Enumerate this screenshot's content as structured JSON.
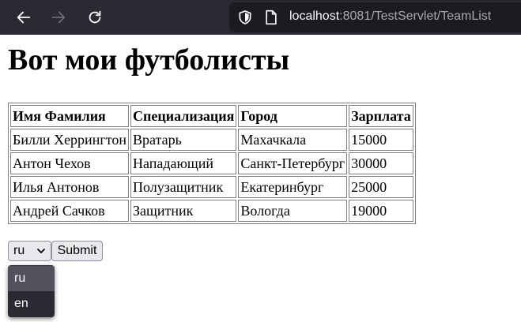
{
  "browser": {
    "url_host": "localhost",
    "url_rest": ":8081/TestServlet/TeamList"
  },
  "page": {
    "title": "Вот мои футболисты"
  },
  "table": {
    "headers": [
      "Имя Фамилия",
      "Специализация",
      "Город",
      "Зарплата"
    ],
    "rows": [
      [
        "Билли Херрингтон",
        "Вратарь",
        "Махачкала",
        "15000"
      ],
      [
        "Антон Чехов",
        "Нападающий",
        "Санкт-Петербург",
        "30000"
      ],
      [
        "Илья Антонов",
        "Полузащитник",
        "Екатеринбург",
        "25000"
      ],
      [
        "Андрей Сачков",
        "Защитник",
        "Вологда",
        "19000"
      ]
    ]
  },
  "form": {
    "language_value": "ru",
    "submit_label": "Submit",
    "options": [
      "ru",
      "en"
    ]
  },
  "icons": {
    "back": "arrow-left-icon",
    "forward": "arrow-right-icon",
    "reload": "reload-icon",
    "shield": "shield-icon",
    "page": "page-icon",
    "chevron": "chevron-down-icon"
  },
  "colors": {
    "toolbar_bg": "#2b2a33",
    "urlbar_bg": "#1c1b22",
    "dropdown_bg": "#2b2a33",
    "dropdown_selected": "#52525e"
  }
}
